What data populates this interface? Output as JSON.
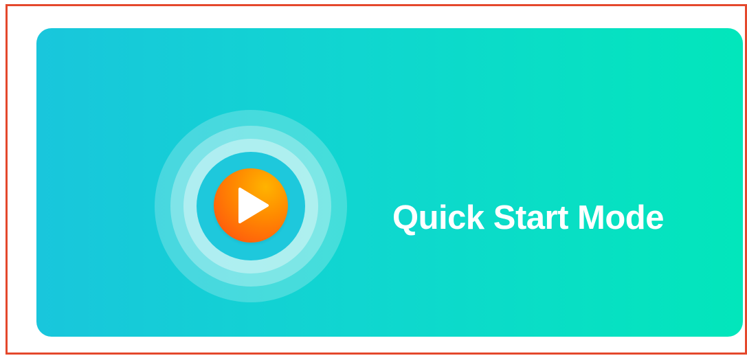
{
  "card": {
    "title": "Quick Start Mode",
    "icon": "play-icon"
  },
  "colors": {
    "frame_border": "#e4482c",
    "card_gradient_start": "#19c6dc",
    "card_gradient_end": "#02e6bb",
    "play_button_orange": "#ff8a00",
    "play_button_red": "#ff4a12",
    "text": "#ffffff"
  }
}
